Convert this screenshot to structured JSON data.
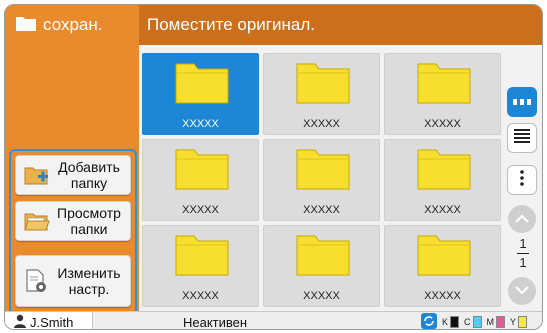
{
  "sidebar": {
    "title": "сохран.",
    "buttons": [
      {
        "line1": "Добавить",
        "line2": "папку",
        "icon": "add-folder-icon"
      },
      {
        "line1": "Просмотр",
        "line2": "папки",
        "icon": "open-folder-icon"
      },
      {
        "line1": "Изменить",
        "line2": "настр.",
        "icon": "document-settings-icon"
      }
    ]
  },
  "header": {
    "message": "Поместите оригинал."
  },
  "folders": [
    {
      "label": "XXXXX",
      "selected": true
    },
    {
      "label": "XXXXX",
      "selected": false
    },
    {
      "label": "XXXXX",
      "selected": false
    },
    {
      "label": "XXXXX",
      "selected": false
    },
    {
      "label": "XXXXX",
      "selected": false
    },
    {
      "label": "XXXXX",
      "selected": false
    },
    {
      "label": "XXXXX",
      "selected": false
    },
    {
      "label": "XXXXX",
      "selected": false
    },
    {
      "label": "XXXXX",
      "selected": false
    }
  ],
  "view_controls": {
    "grid_view": "grid-view-icon",
    "list_view": "list-view-icon",
    "more": "more-vertical-icon"
  },
  "pager": {
    "current": "1",
    "total": "1"
  },
  "status": {
    "user": "J.Smith",
    "state": "Неактивен",
    "ink": [
      {
        "label": "K",
        "color": "#111111"
      },
      {
        "label": "C",
        "color": "#5cc8f0"
      },
      {
        "label": "M",
        "color": "#e8559a"
      },
      {
        "label": "Y",
        "color": "#f5e84a"
      }
    ]
  },
  "colors": {
    "sidebar": "#e98a2c",
    "header": "#cc6f1c",
    "accent": "#1e86d6",
    "folder": "#f7df2e"
  }
}
